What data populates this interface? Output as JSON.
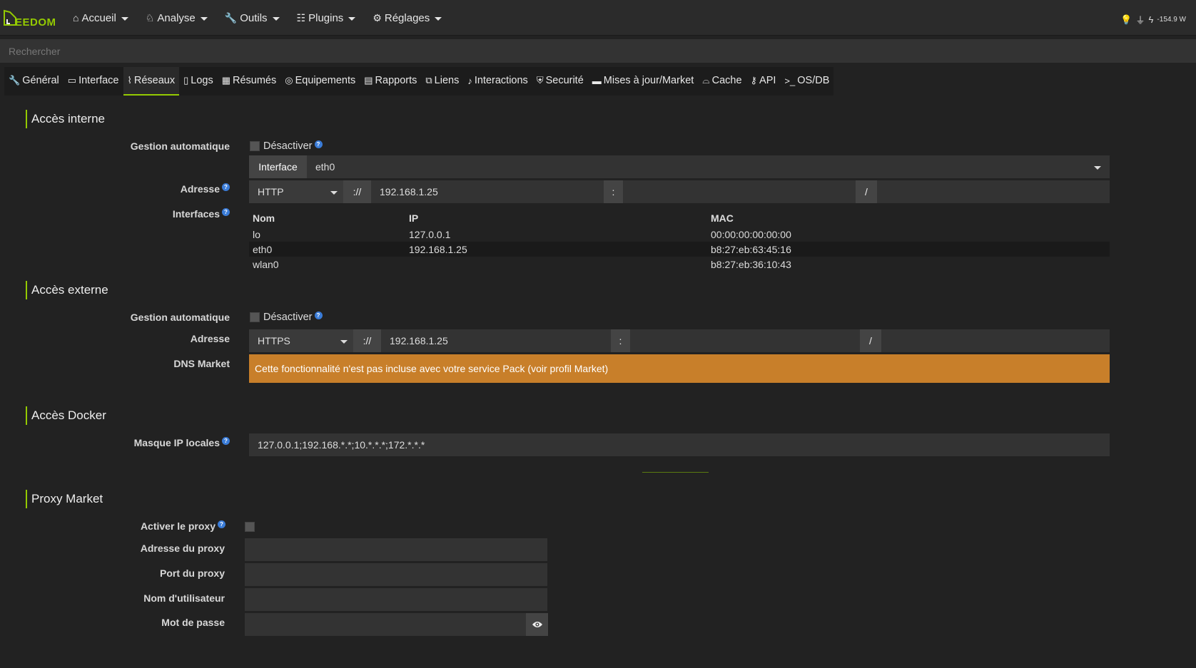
{
  "brand": {
    "text": "EEDOM"
  },
  "nav": {
    "items": [
      {
        "icon": "⌂",
        "label": "Accueil"
      },
      {
        "icon": "♘",
        "label": "Analyse"
      },
      {
        "icon": "🔧",
        "label": "Outils"
      },
      {
        "icon": "☷",
        "label": "Plugins"
      },
      {
        "icon": "⚙",
        "label": "Réglages"
      }
    ],
    "power": "-154.9 W"
  },
  "search": {
    "placeholder": "Rechercher"
  },
  "tabs": [
    {
      "icon": "🔧",
      "label": "Général"
    },
    {
      "icon": "▭",
      "label": "Interface"
    },
    {
      "icon": "⌇",
      "label": "Réseaux"
    },
    {
      "icon": "▯",
      "label": "Logs"
    },
    {
      "icon": "▦",
      "label": "Résumés"
    },
    {
      "icon": "◎",
      "label": "Equipements"
    },
    {
      "icon": "▤",
      "label": "Rapports"
    },
    {
      "icon": "⧉",
      "label": "Liens"
    },
    {
      "icon": "♪",
      "label": "Interactions"
    },
    {
      "icon": "⛨",
      "label": "Securité"
    },
    {
      "icon": "▬",
      "label": "Mises à jour/Market"
    },
    {
      "icon": "⌓",
      "label": "Cache"
    },
    {
      "icon": "⚷",
      "label": "API"
    },
    {
      "icon": ">_",
      "label": "OS/DB"
    }
  ],
  "internal": {
    "title": "Accès interne",
    "auto_label": "Gestion automatique",
    "disable_label": "Désactiver",
    "interface_addon": "Interface",
    "interface_value": "eth0",
    "address_label": "Adresse",
    "protocol": "HTTP",
    "sep_proto": "://",
    "ip": "192.168.1.25",
    "sep_port": ":",
    "sep_path": "/",
    "interfaces_label": "Interfaces",
    "table_headers": [
      "Nom",
      "IP",
      "MAC"
    ],
    "table_rows": [
      [
        "lo",
        "127.0.0.1",
        "00:00:00:00:00:00"
      ],
      [
        "eth0",
        "192.168.1.25",
        "b8:27:eb:63:45:16"
      ],
      [
        "wlan0",
        "",
        "b8:27:eb:36:10:43"
      ]
    ]
  },
  "external": {
    "title": "Accès externe",
    "auto_label": "Gestion automatique",
    "disable_label": "Désactiver",
    "address_label": "Adresse",
    "protocol": "HTTPS",
    "sep_proto": "://",
    "ip": "192.168.1.25",
    "sep_port": ":",
    "sep_path": "/",
    "dns_label": "DNS Market",
    "dns_alert": "Cette fonctionnalité n'est pas incluse avec votre service Pack (voir profil Market)"
  },
  "docker": {
    "title": "Accès Docker",
    "mask_label": "Masque IP locales",
    "mask_value": "127.0.0.1;192.168.*.*;10.*.*.*;172.*.*.*"
  },
  "proxy": {
    "title": "Proxy Market",
    "enable_label": "Activer le proxy",
    "address_label": "Adresse du proxy",
    "port_label": "Port du proxy",
    "user_label": "Nom d'utilisateur",
    "password_label": "Mot de passe"
  }
}
